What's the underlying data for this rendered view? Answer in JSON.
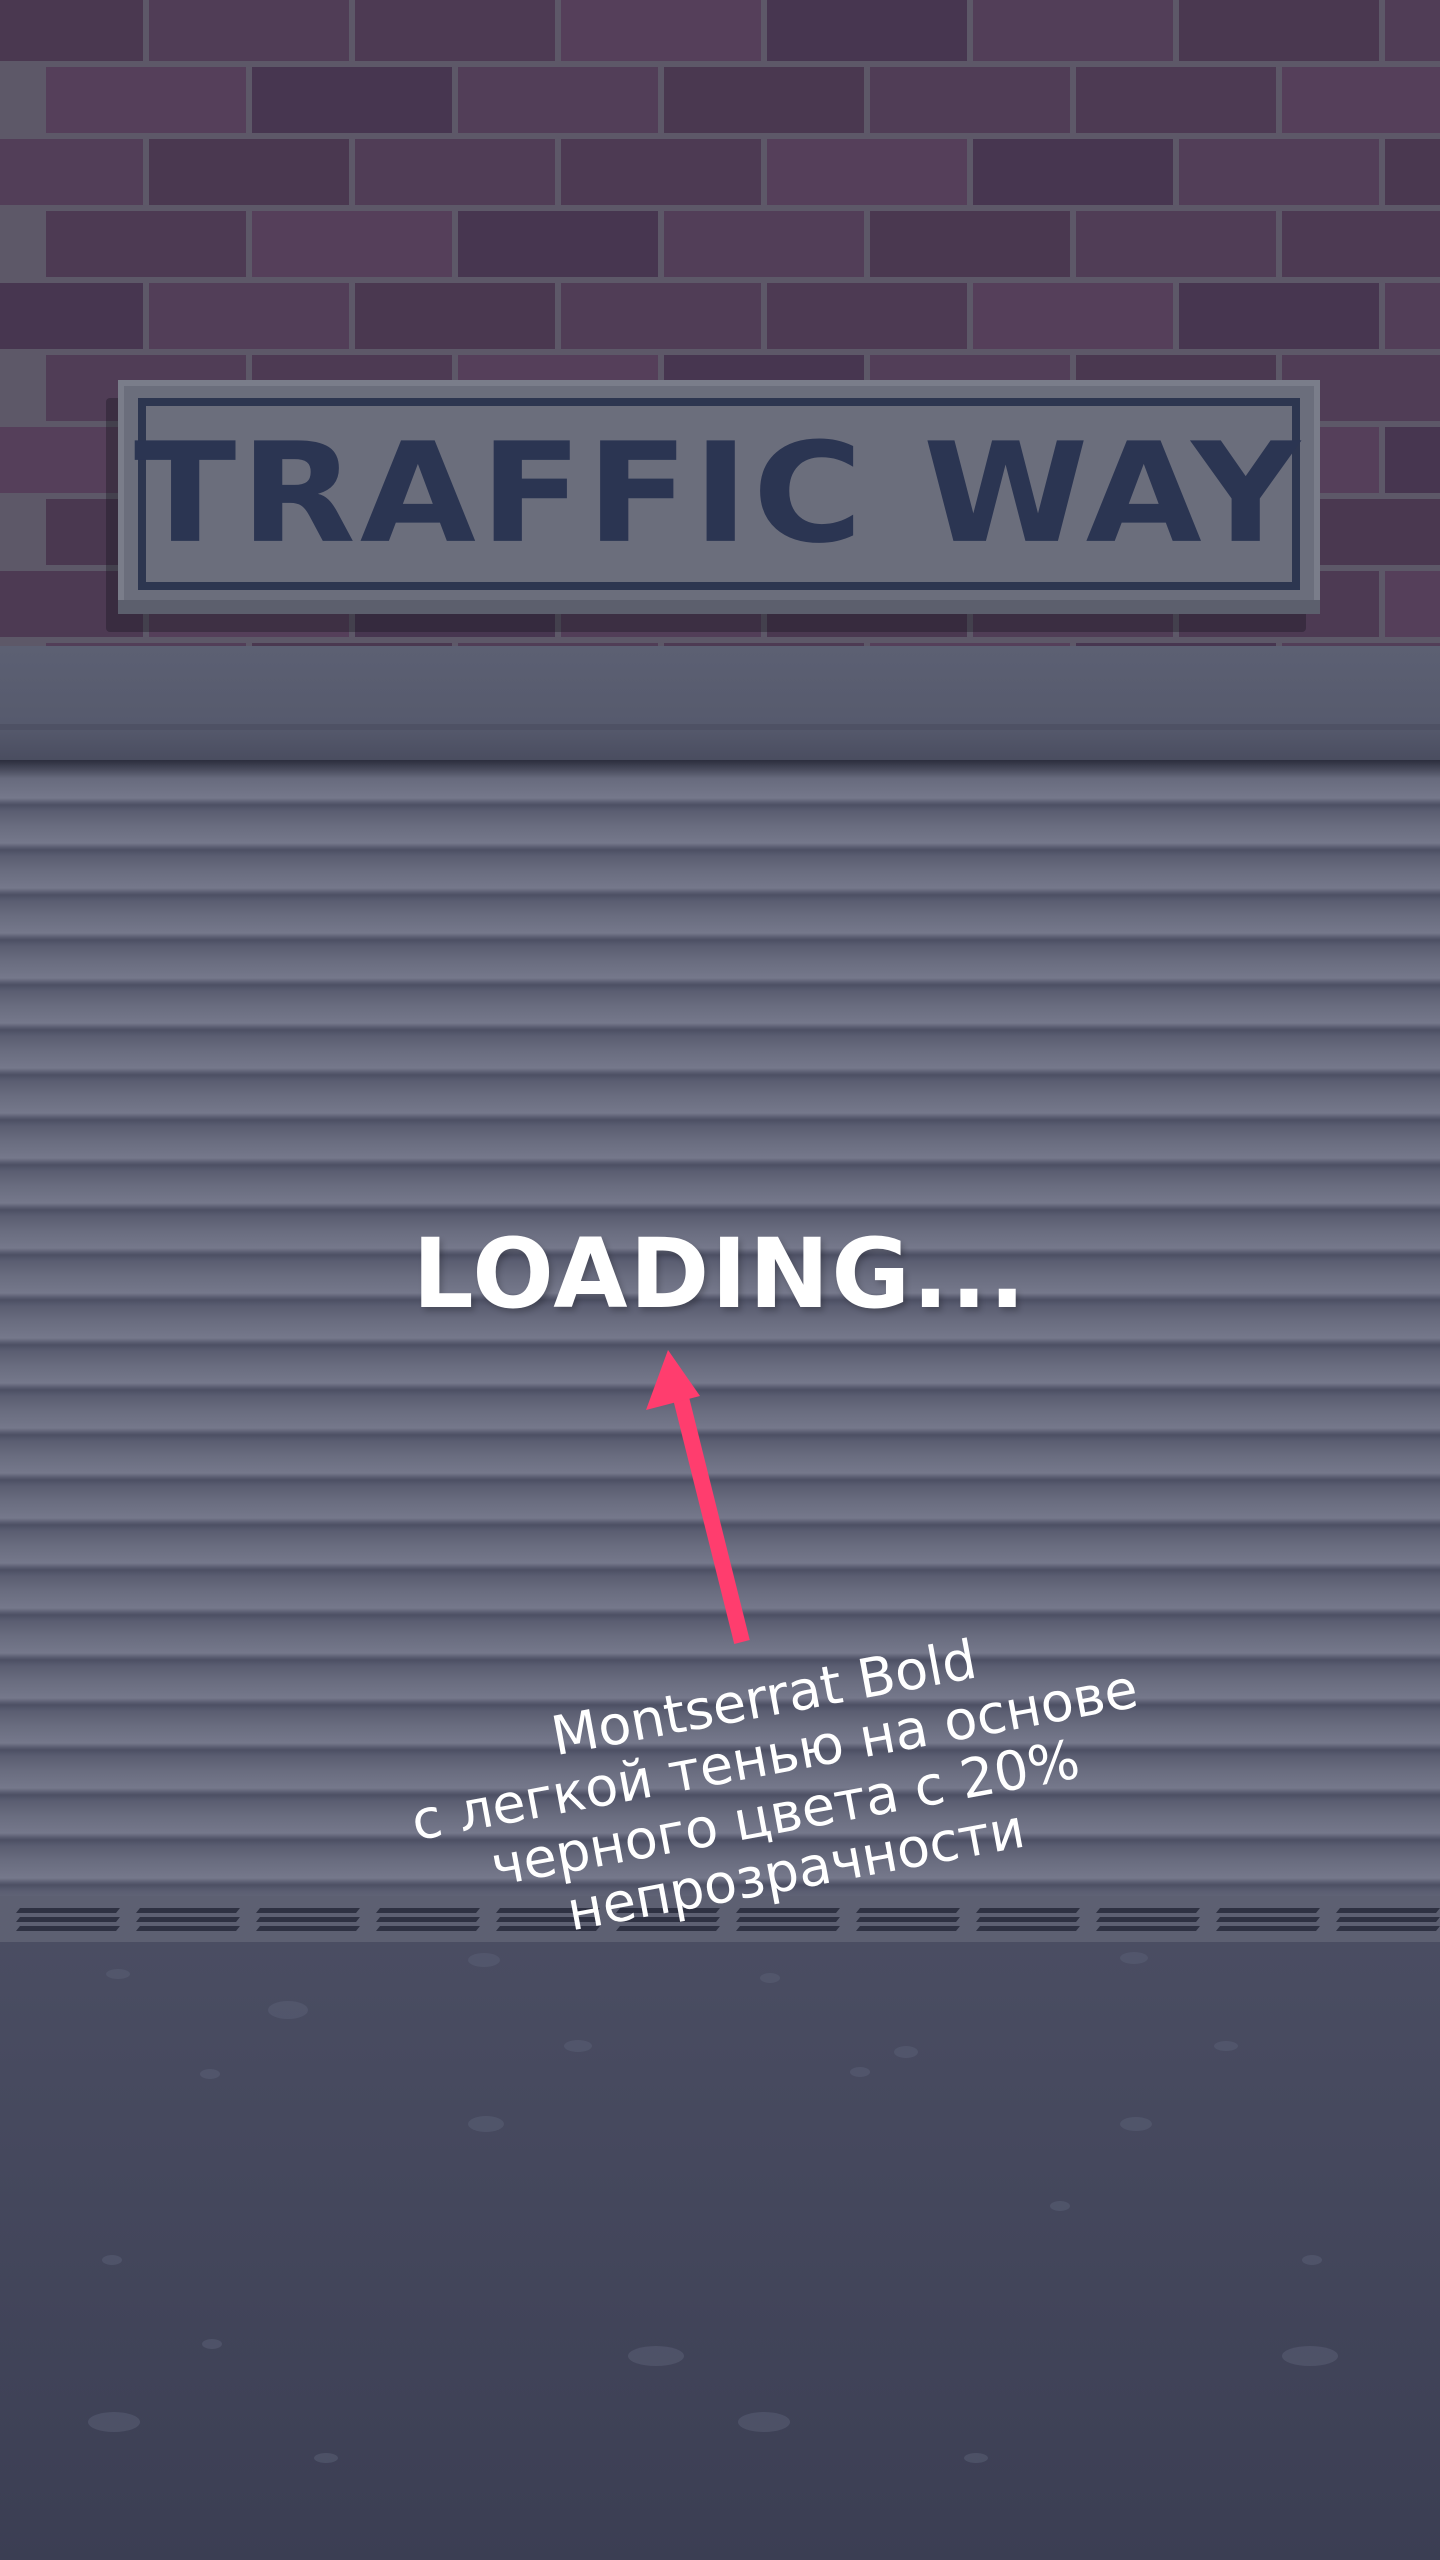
{
  "sign": {
    "title": "TRAFFIC WAY"
  },
  "loading": {
    "text": "LOADING..."
  },
  "annotation": {
    "lines": [
      "Montserrat Bold",
      "с легкой тенью на основе",
      "черного цвета с 20%",
      "непрозрачности"
    ],
    "arrow_color": "#ff3d6e"
  },
  "colors": {
    "brick": "#4c3a52",
    "mortar": "#5d5868",
    "sign_face": "#6b6e7c",
    "sign_text": "#2b3552",
    "shutter": "#6a6d80",
    "floor": "#43465b",
    "accent": "#ff3d6e"
  }
}
